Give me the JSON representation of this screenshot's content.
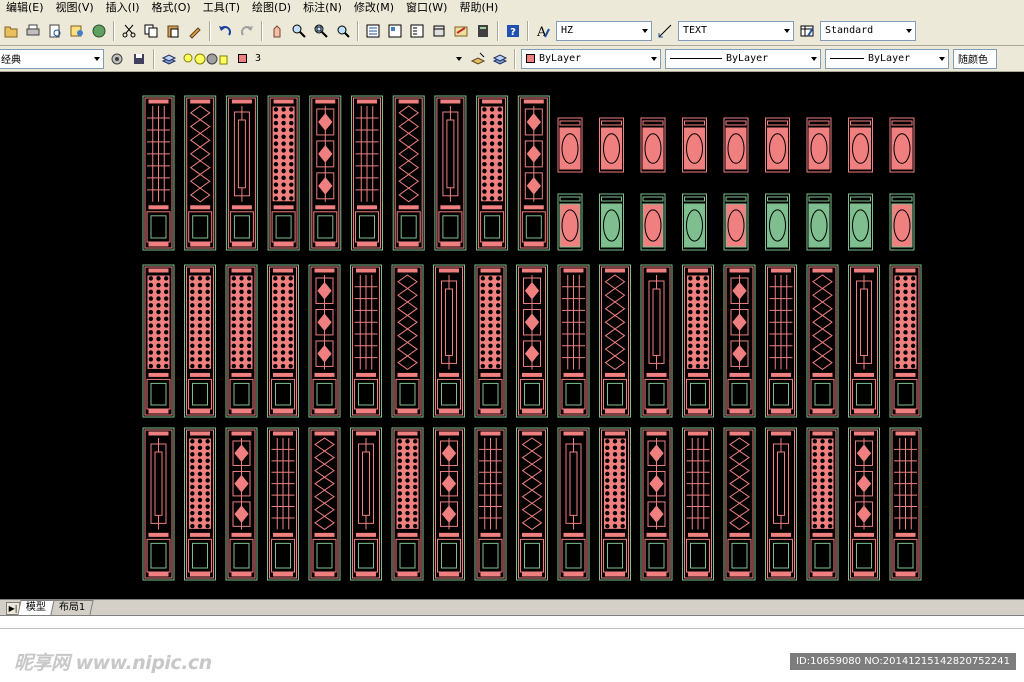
{
  "menu": [
    "编辑(E)",
    "视图(V)",
    "插入(I)",
    "格式(O)",
    "工具(T)",
    "绘图(D)",
    "标注(N)",
    "修改(M)",
    "窗口(W)",
    "帮助(H)"
  ],
  "toolbar1": {
    "text_style": "HZ",
    "dim_style": "TEXT",
    "table_style": "Standard"
  },
  "toolbar2": {
    "workspace": "经典",
    "layer": "3",
    "color": "ByLayer",
    "linetype": "ByLayer",
    "lineweight": "ByLayer",
    "plot_style": "随颜色",
    "layer_color": "#f08080"
  },
  "tabs": {
    "model": "模型",
    "layout1": "布局1"
  },
  "watermark": "昵享网 www.nipic.cn",
  "image_id": "ID:10659080 NO:20141215142820752241",
  "colors": {
    "canvas": "#000000",
    "pink": "#f08080",
    "green": "#7fbf8f"
  }
}
